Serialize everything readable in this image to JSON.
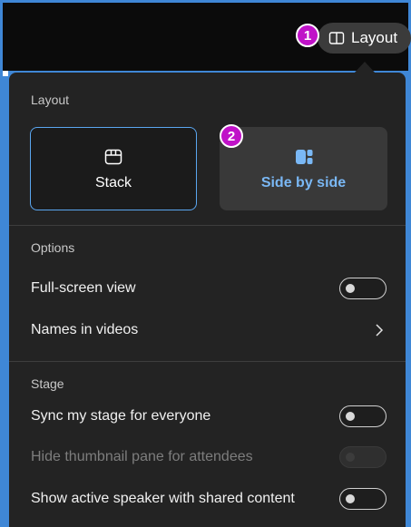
{
  "header": {
    "layout_button_label": "Layout",
    "badge_1": "1",
    "badge_2": "2"
  },
  "panel": {
    "layout_section": {
      "title": "Layout",
      "options": [
        {
          "label": "Stack",
          "icon": "stack-icon",
          "selected": true
        },
        {
          "label": "Side by side",
          "icon": "side-by-side-icon",
          "selected": false
        }
      ]
    },
    "options_section": {
      "title": "Options",
      "full_screen_label": "Full-screen view",
      "full_screen_on": false,
      "names_in_videos_label": "Names in videos"
    },
    "stage_section": {
      "title": "Stage",
      "sync_label": "Sync my stage for everyone",
      "sync_on": false,
      "hide_thumbnail_label": "Hide thumbnail pane for attendees",
      "hide_thumbnail_disabled": true,
      "active_speaker_label": "Show active speaker with shared content",
      "active_speaker_on": false
    }
  },
  "colors": {
    "accent": "#5aa6f0",
    "badge": "#c012c8",
    "panel_bg": "#232323"
  }
}
